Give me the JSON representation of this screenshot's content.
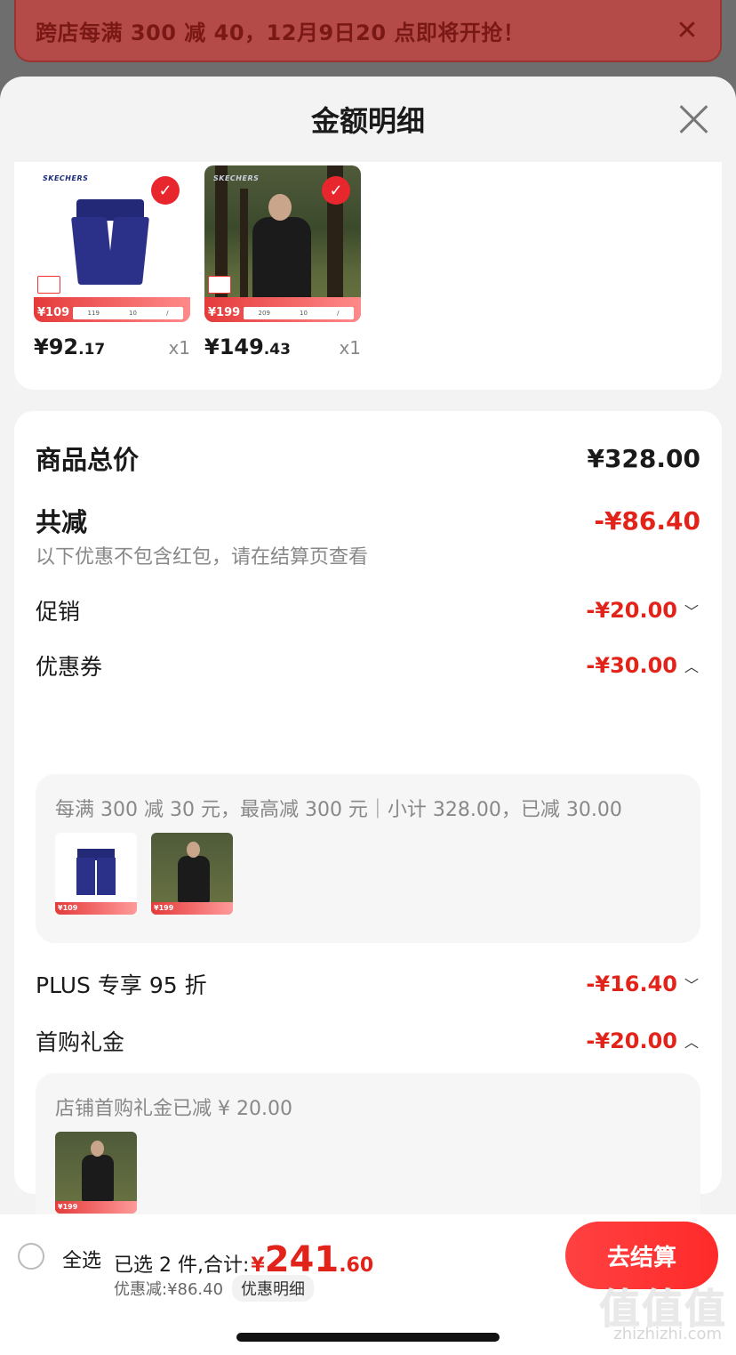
{
  "banner": {
    "text": "跨店每满 300 减 40，12月9日20 点即将开抢！"
  },
  "sheet": {
    "title": "金额明细"
  },
  "products": [
    {
      "price_main": "¥92",
      "price_dec": ".17",
      "qty": "x1",
      "tag_price": "109",
      "tag_vals": [
        "119",
        "10",
        "/"
      ]
    },
    {
      "price_main": "¥149",
      "price_dec": ".43",
      "qty": "x1",
      "tag_price": "199",
      "tag_vals": [
        "209",
        "10",
        "/"
      ]
    }
  ],
  "summary": {
    "total_label": "商品总价",
    "total_value": "¥328.00",
    "reduce_label": "共减",
    "reduce_value": "-¥86.40",
    "note": "以下优惠不包含红包，请在结算页查看",
    "promo_label": "促销",
    "promo_value": "-¥20.00",
    "coupon_label": "优惠券",
    "coupon_value": "-¥30.00",
    "coupon_detail": "每满 300 减 30 元，最高减 300 元｜小计 328.00，已减 30.00",
    "plus_label": "PLUS 专享 95 折",
    "plus_value": "-¥16.40",
    "gift_label": "首购礼金",
    "gift_value": "-¥20.00",
    "gift_detail": "店铺首购礼金已减 ¥ 20.00",
    "mini_tags": [
      "109",
      "199",
      "199"
    ]
  },
  "bottom": {
    "select_all": "全选",
    "selected": "已选 2 件,合计:",
    "total_currency": "¥",
    "total_int": "241",
    "total_dec": ".60",
    "discount": "优惠减:¥86.40",
    "detail_link": "优惠明细",
    "checkout": "去结算"
  },
  "watermark": {
    "main": "值值值",
    "sub": "zhizhizhi.com"
  },
  "icons": {
    "close": "close-icon",
    "check": "check-icon",
    "chevron_down": "chevron-down-icon",
    "chevron_up": "chevron-up-icon"
  },
  "colors": {
    "accent": "#e2231a",
    "banner_bg": "#b44b48"
  }
}
